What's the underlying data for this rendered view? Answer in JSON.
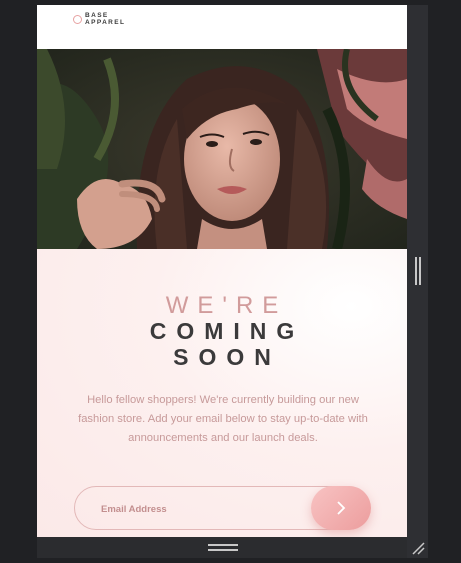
{
  "brand": {
    "logo_text": "BASE\nAPPAREL"
  },
  "hero": {
    "image": "portrait-photo"
  },
  "headline": {
    "line1": "WE'RE",
    "line2": "COMING",
    "line3": "SOON"
  },
  "description": "Hello fellow shoppers! We're currently building our new fashion store. Add your email below to stay up-to-date with announcements and our launch deals.",
  "form": {
    "email_placeholder": "Email Address",
    "submit_icon": "chevron-right-icon"
  },
  "colors": {
    "accent": "#e7a2a2",
    "headline_light": "#d19b9b",
    "headline_dark": "#3b3a3b",
    "text": "#c79a9a"
  }
}
